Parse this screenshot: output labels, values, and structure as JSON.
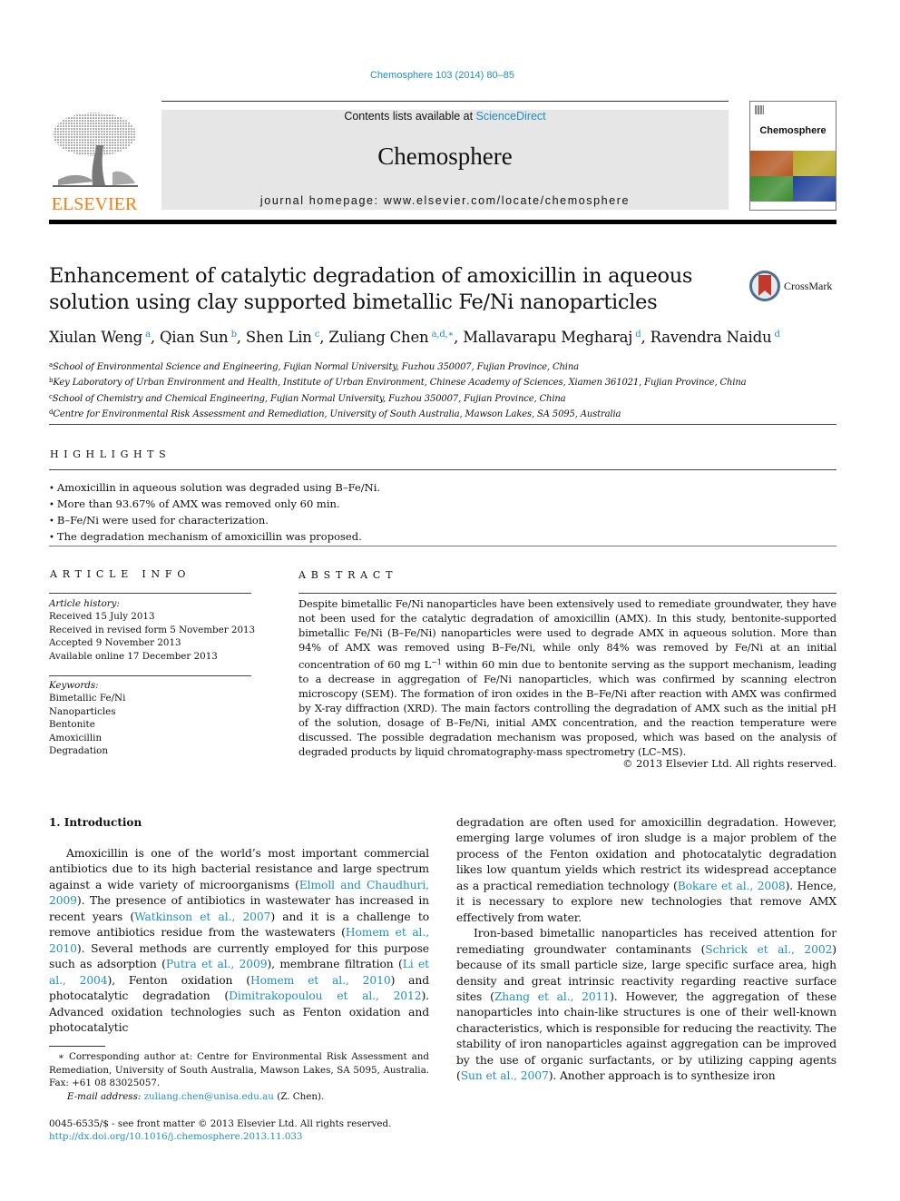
{
  "header": {
    "journal_ref": "Chemosphere 103 (2014) 80–85",
    "contents_prefix": "Contents lists available at ",
    "contents_link": "ScienceDirect",
    "journal_name": "Chemosphere",
    "homepage": "journal homepage: www.elsevier.com/locate/chemosphere",
    "publisher_logo_text": "ELSEVIER",
    "cover_title": "Chemosphere",
    "cover_colors": [
      "#b4561f",
      "#b8a827",
      "#3b8a2e",
      "#23439a"
    ]
  },
  "article": {
    "title": "Enhancement of catalytic degradation of amoxicillin in aqueous solution using clay supported bimetallic Fe/Ni nanoparticles",
    "crossmark_label": "CrossMark",
    "authors": [
      {
        "name": "Xiulan Weng",
        "sup": "a"
      },
      {
        "name": "Qian Sun",
        "sup": "b"
      },
      {
        "name": "Shen Lin",
        "sup": "c"
      },
      {
        "name": "Zuliang Chen",
        "sup": "a,d,∗"
      },
      {
        "name": "Mallavarapu Megharaj",
        "sup": "d"
      },
      {
        "name": "Ravendra Naidu",
        "sup": "d"
      }
    ],
    "affiliations": [
      {
        "key": "a",
        "text": "School of Environmental Science and Engineering, Fujian Normal University, Fuzhou 350007, Fujian Province, China"
      },
      {
        "key": "b",
        "text": "Key Laboratory of Urban Environment and Health, Institute of Urban Environment, Chinese Academy of Sciences, Xiamen 361021, Fujian Province, China"
      },
      {
        "key": "c",
        "text": "School of Chemistry and Chemical Engineering, Fujian Normal University, Fuzhou 350007, Fujian Province, China"
      },
      {
        "key": "d",
        "text": "Centre for Environmental Risk Assessment and Remediation, University of South Australia, Mawson Lakes, SA 5095, Australia"
      }
    ]
  },
  "highlights": {
    "heading": "HIGHLIGHTS",
    "items": [
      "Amoxicillin in aqueous solution was degraded using B–Fe/Ni.",
      "More than 93.67% of AMX was removed only 60 min.",
      "B–Fe/Ni were used for characterization.",
      "The degradation mechanism of amoxicillin was proposed."
    ]
  },
  "article_info": {
    "heading": "ARTICLE INFO",
    "history_label": "Article history:",
    "history": [
      "Received 15 July 2013",
      "Received in revised form 5 November 2013",
      "Accepted 9 November 2013",
      "Available online 17 December 2013"
    ],
    "keywords_label": "Keywords:",
    "keywords": [
      "Bimetallic Fe/Ni",
      "Nanoparticles",
      "Bentonite",
      "Amoxicillin",
      "Degradation"
    ]
  },
  "abstract": {
    "heading": "ABSTRACT",
    "text_before_sup": "Despite bimetallic Fe/Ni nanoparticles have been extensively used to remediate groundwater, they have not been used for the catalytic degradation of amoxicillin (AMX). In this study, bentonite-supported bimetallic Fe/Ni (B–Fe/Ni) nanoparticles were used to degrade AMX in aqueous solution. More than 94% of AMX was removed using B–Fe/Ni, while only 84% was removed by Fe/Ni at an initial concentration of 60 mg L",
    "sup": "−1",
    "text_after_sup": " within 60 min due to bentonite serving as the support mechanism, leading to a decrease in aggregation of Fe/Ni nanoparticles, which was confirmed by scanning electron microscopy (SEM). The formation of iron oxides in the B–Fe/Ni after reaction with AMX was confirmed by X-ray diffraction (XRD). The main factors controlling the degradation of AMX such as the initial pH of the solution, dosage of B–Fe/Ni, initial AMX concentration, and the reaction temperature were discussed. The possible degradation mechanism was proposed, which was based on the analysis of degraded products by liquid chromatography-mass spectrometry (LC–MS).",
    "copyright": "© 2013 Elsevier Ltd. All rights reserved."
  },
  "introduction": {
    "heading": "1. Introduction",
    "left_para": [
      {
        "t": "Amoxicillin is one of the world’s most important commercial antibiotics due to its high bacterial resistance and large spectrum against a wide variety of microorganisms ("
      },
      {
        "l": "Elmoll and Chaudhuri, 2009"
      },
      {
        "t": "). The presence of antibiotics in wastewater has increased in recent years ("
      },
      {
        "l": "Watkinson et al., 2007"
      },
      {
        "t": ") and it is a challenge to remove antibiotics residue from the wastewaters ("
      },
      {
        "l": "Homem et al., 2010"
      },
      {
        "t": "). Several methods are currently employed for this purpose such as adsorption ("
      },
      {
        "l": "Putra et al., 2009"
      },
      {
        "t": "), membrane filtration ("
      },
      {
        "l": "Li et al., 2004"
      },
      {
        "t": "), Fenton oxidation ("
      },
      {
        "l": "Homem et al., 2010"
      },
      {
        "t": ") and photocatalytic degradation ("
      },
      {
        "l": "Dimitrakopoulou et al., 2012"
      },
      {
        "t": "). Advanced oxidation technologies such as Fenton oxidation and photocatalytic"
      }
    ],
    "right_para1": [
      {
        "t": "degradation are often used for amoxicillin degradation. However, emerging large volumes of iron sludge is a major problem of the process of the Fenton oxidation and photocatalytic degradation likes low quantum yields which restrict its widespread acceptance as a practical remediation technology ("
      },
      {
        "l": "Bokare et al., 2008"
      },
      {
        "t": "). Hence, it is necessary to explore new technologies that remove AMX effectively from water."
      }
    ],
    "right_para2": [
      {
        "t": "Iron-based bimetallic nanoparticles has received attention for remediating groundwater contaminants ("
      },
      {
        "l": "Schrick et al., 2002"
      },
      {
        "t": ") because of its small particle size, large specific surface area, high density and great intrinsic reactivity regarding reactive surface sites ("
      },
      {
        "l": "Zhang et al., 2011"
      },
      {
        "t": "). However, the aggregation of these nanoparticles into chain-like structures is one of their well-known characteristics, which is responsible for reducing the reactivity. The stability of iron nanoparticles against aggregation can be improved by the use of organic surfactants, or by utilizing capping agents ("
      },
      {
        "l": "Sun et al., 2007"
      },
      {
        "t": "). Another approach is to synthesize iron"
      }
    ]
  },
  "footnotes": {
    "corresponding": "∗ Corresponding author at: Centre for Environmental Risk Assessment and Remediation, University of South Australia, Mawson Lakes, SA 5095, Australia. Fax: +61 08 83025057.",
    "email_label": "E-mail address:",
    "email": "zuliang.chen@unisa.edu.au",
    "email_suffix": " (Z. Chen).",
    "front_matter": "0045-6535/$ - see front matter © 2013 Elsevier Ltd. All rights reserved.",
    "doi": "http://dx.doi.org/10.1016/j.chemosphere.2013.11.033"
  }
}
